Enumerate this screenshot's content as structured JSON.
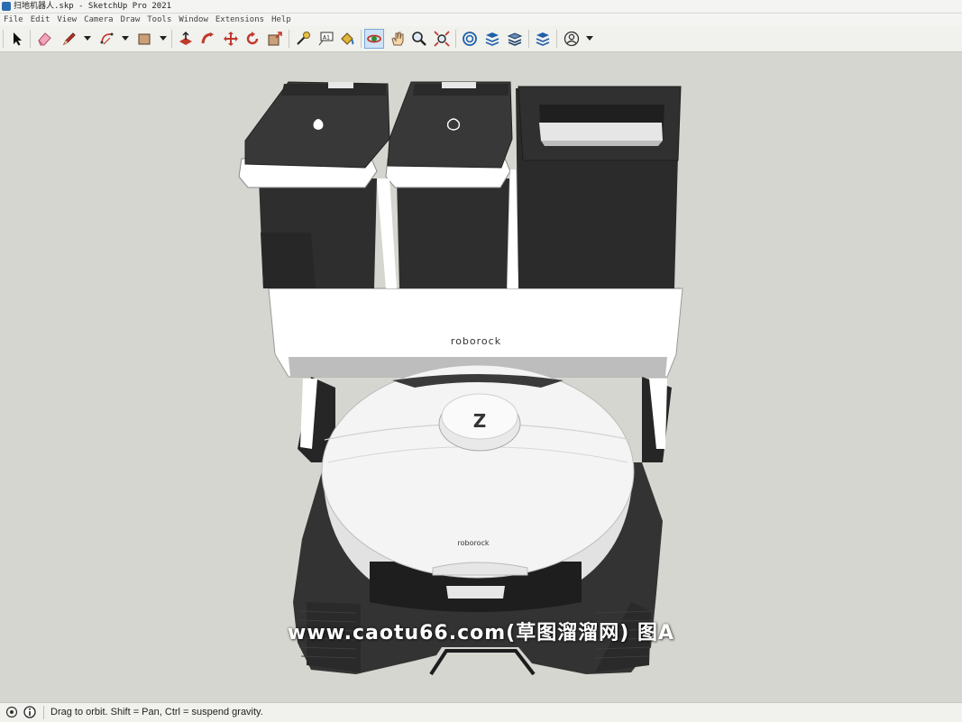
{
  "window": {
    "title": "扫地机器人.skp - SketchUp Pro 2021"
  },
  "menu": [
    "File",
    "Edit",
    "View",
    "Camera",
    "Draw",
    "Tools",
    "Window",
    "Extensions",
    "Help"
  ],
  "toolbar": {
    "tools": [
      {
        "name": "select-tool",
        "icon": "arrow-icon"
      },
      {
        "name": "eraser-tool",
        "icon": "eraser-icon"
      },
      {
        "name": "line-tool",
        "icon": "pencil-icon"
      },
      {
        "name": "arc-tool",
        "icon": "arc-icon"
      },
      {
        "name": "rectangle-tool",
        "icon": "rectangle-icon"
      },
      {
        "name": "push-pull-tool",
        "icon": "push-pull-icon"
      },
      {
        "name": "follow-me-tool",
        "icon": "follow-me-icon"
      },
      {
        "name": "move-tool",
        "icon": "move-icon"
      },
      {
        "name": "rotate-tool",
        "icon": "rotate-icon"
      },
      {
        "name": "scale-tool",
        "icon": "scale-icon"
      },
      {
        "name": "tape-measure-tool",
        "icon": "tape-measure-icon"
      },
      {
        "name": "text-tool",
        "icon": "text-icon"
      },
      {
        "name": "paint-bucket-tool",
        "icon": "paint-bucket-icon"
      },
      {
        "name": "orbit-tool",
        "icon": "orbit-icon"
      },
      {
        "name": "pan-tool",
        "icon": "pan-hand-icon"
      },
      {
        "name": "zoom-tool",
        "icon": "zoom-icon"
      },
      {
        "name": "zoom-extents-tool",
        "icon": "zoom-extents-icon"
      },
      {
        "name": "warehouse-button",
        "icon": "warehouse-icon"
      },
      {
        "name": "extension-warehouse-button",
        "icon": "extension-warehouse-icon"
      },
      {
        "name": "layout-button",
        "icon": "layers-icon"
      },
      {
        "name": "extension-manager-button",
        "icon": "extension-manager-icon"
      },
      {
        "name": "account-button",
        "icon": "user-icon"
      }
    ],
    "text_tool_label": "A1"
  },
  "model": {
    "brand_top": "roborock",
    "brand_robot": "roborock",
    "logo_letter": "Z"
  },
  "watermark": "www.caotu66.com(草图溜溜网) 图A",
  "status": {
    "message": "Drag to orbit. Shift = Pan, Ctrl = suspend gravity."
  }
}
